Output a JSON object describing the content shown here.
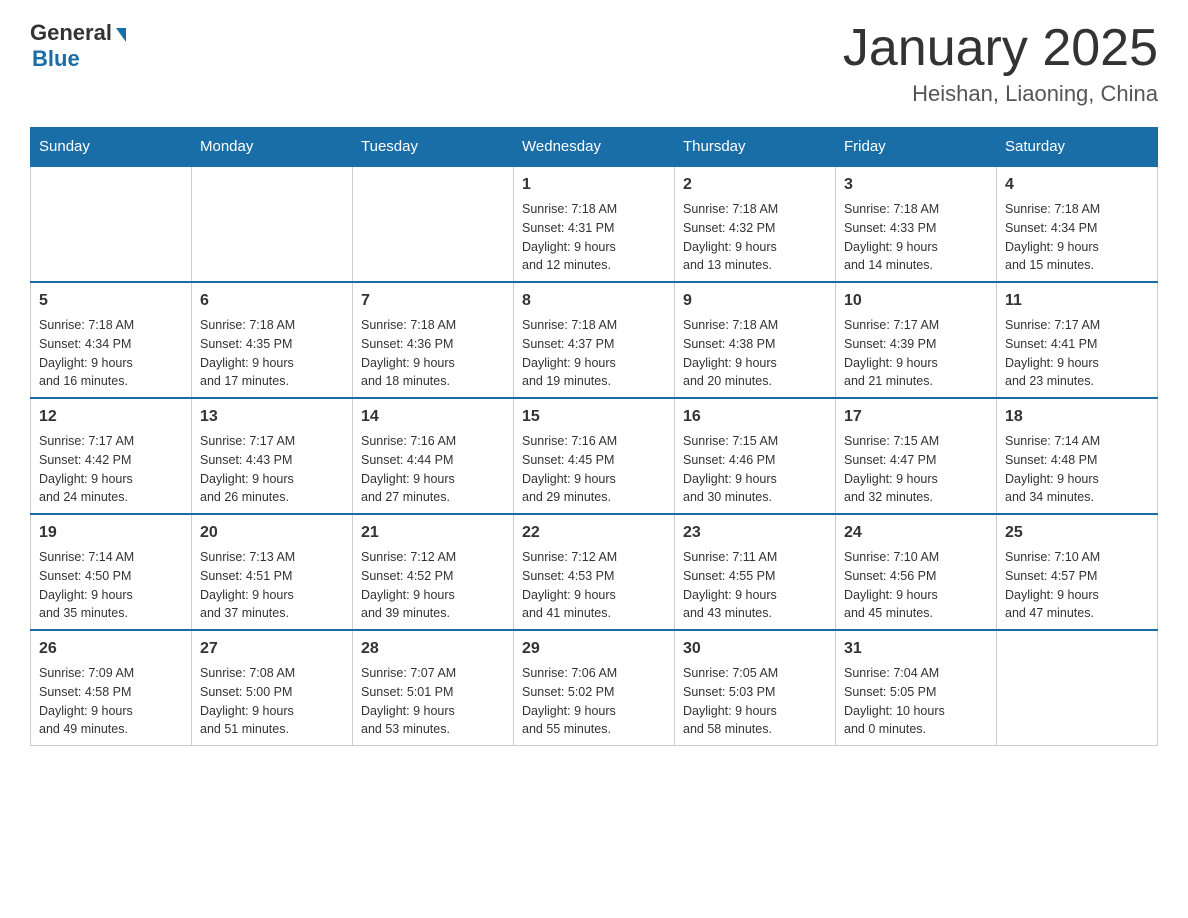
{
  "header": {
    "logo_general": "General",
    "logo_blue": "Blue",
    "month_title": "January 2025",
    "location": "Heishan, Liaoning, China"
  },
  "weekdays": [
    "Sunday",
    "Monday",
    "Tuesday",
    "Wednesday",
    "Thursday",
    "Friday",
    "Saturday"
  ],
  "weeks": [
    [
      {
        "day": "",
        "info": ""
      },
      {
        "day": "",
        "info": ""
      },
      {
        "day": "",
        "info": ""
      },
      {
        "day": "1",
        "info": "Sunrise: 7:18 AM\nSunset: 4:31 PM\nDaylight: 9 hours\nand 12 minutes."
      },
      {
        "day": "2",
        "info": "Sunrise: 7:18 AM\nSunset: 4:32 PM\nDaylight: 9 hours\nand 13 minutes."
      },
      {
        "day": "3",
        "info": "Sunrise: 7:18 AM\nSunset: 4:33 PM\nDaylight: 9 hours\nand 14 minutes."
      },
      {
        "day": "4",
        "info": "Sunrise: 7:18 AM\nSunset: 4:34 PM\nDaylight: 9 hours\nand 15 minutes."
      }
    ],
    [
      {
        "day": "5",
        "info": "Sunrise: 7:18 AM\nSunset: 4:34 PM\nDaylight: 9 hours\nand 16 minutes."
      },
      {
        "day": "6",
        "info": "Sunrise: 7:18 AM\nSunset: 4:35 PM\nDaylight: 9 hours\nand 17 minutes."
      },
      {
        "day": "7",
        "info": "Sunrise: 7:18 AM\nSunset: 4:36 PM\nDaylight: 9 hours\nand 18 minutes."
      },
      {
        "day": "8",
        "info": "Sunrise: 7:18 AM\nSunset: 4:37 PM\nDaylight: 9 hours\nand 19 minutes."
      },
      {
        "day": "9",
        "info": "Sunrise: 7:18 AM\nSunset: 4:38 PM\nDaylight: 9 hours\nand 20 minutes."
      },
      {
        "day": "10",
        "info": "Sunrise: 7:17 AM\nSunset: 4:39 PM\nDaylight: 9 hours\nand 21 minutes."
      },
      {
        "day": "11",
        "info": "Sunrise: 7:17 AM\nSunset: 4:41 PM\nDaylight: 9 hours\nand 23 minutes."
      }
    ],
    [
      {
        "day": "12",
        "info": "Sunrise: 7:17 AM\nSunset: 4:42 PM\nDaylight: 9 hours\nand 24 minutes."
      },
      {
        "day": "13",
        "info": "Sunrise: 7:17 AM\nSunset: 4:43 PM\nDaylight: 9 hours\nand 26 minutes."
      },
      {
        "day": "14",
        "info": "Sunrise: 7:16 AM\nSunset: 4:44 PM\nDaylight: 9 hours\nand 27 minutes."
      },
      {
        "day": "15",
        "info": "Sunrise: 7:16 AM\nSunset: 4:45 PM\nDaylight: 9 hours\nand 29 minutes."
      },
      {
        "day": "16",
        "info": "Sunrise: 7:15 AM\nSunset: 4:46 PM\nDaylight: 9 hours\nand 30 minutes."
      },
      {
        "day": "17",
        "info": "Sunrise: 7:15 AM\nSunset: 4:47 PM\nDaylight: 9 hours\nand 32 minutes."
      },
      {
        "day": "18",
        "info": "Sunrise: 7:14 AM\nSunset: 4:48 PM\nDaylight: 9 hours\nand 34 minutes."
      }
    ],
    [
      {
        "day": "19",
        "info": "Sunrise: 7:14 AM\nSunset: 4:50 PM\nDaylight: 9 hours\nand 35 minutes."
      },
      {
        "day": "20",
        "info": "Sunrise: 7:13 AM\nSunset: 4:51 PM\nDaylight: 9 hours\nand 37 minutes."
      },
      {
        "day": "21",
        "info": "Sunrise: 7:12 AM\nSunset: 4:52 PM\nDaylight: 9 hours\nand 39 minutes."
      },
      {
        "day": "22",
        "info": "Sunrise: 7:12 AM\nSunset: 4:53 PM\nDaylight: 9 hours\nand 41 minutes."
      },
      {
        "day": "23",
        "info": "Sunrise: 7:11 AM\nSunset: 4:55 PM\nDaylight: 9 hours\nand 43 minutes."
      },
      {
        "day": "24",
        "info": "Sunrise: 7:10 AM\nSunset: 4:56 PM\nDaylight: 9 hours\nand 45 minutes."
      },
      {
        "day": "25",
        "info": "Sunrise: 7:10 AM\nSunset: 4:57 PM\nDaylight: 9 hours\nand 47 minutes."
      }
    ],
    [
      {
        "day": "26",
        "info": "Sunrise: 7:09 AM\nSunset: 4:58 PM\nDaylight: 9 hours\nand 49 minutes."
      },
      {
        "day": "27",
        "info": "Sunrise: 7:08 AM\nSunset: 5:00 PM\nDaylight: 9 hours\nand 51 minutes."
      },
      {
        "day": "28",
        "info": "Sunrise: 7:07 AM\nSunset: 5:01 PM\nDaylight: 9 hours\nand 53 minutes."
      },
      {
        "day": "29",
        "info": "Sunrise: 7:06 AM\nSunset: 5:02 PM\nDaylight: 9 hours\nand 55 minutes."
      },
      {
        "day": "30",
        "info": "Sunrise: 7:05 AM\nSunset: 5:03 PM\nDaylight: 9 hours\nand 58 minutes."
      },
      {
        "day": "31",
        "info": "Sunrise: 7:04 AM\nSunset: 5:05 PM\nDaylight: 10 hours\nand 0 minutes."
      },
      {
        "day": "",
        "info": ""
      }
    ]
  ]
}
